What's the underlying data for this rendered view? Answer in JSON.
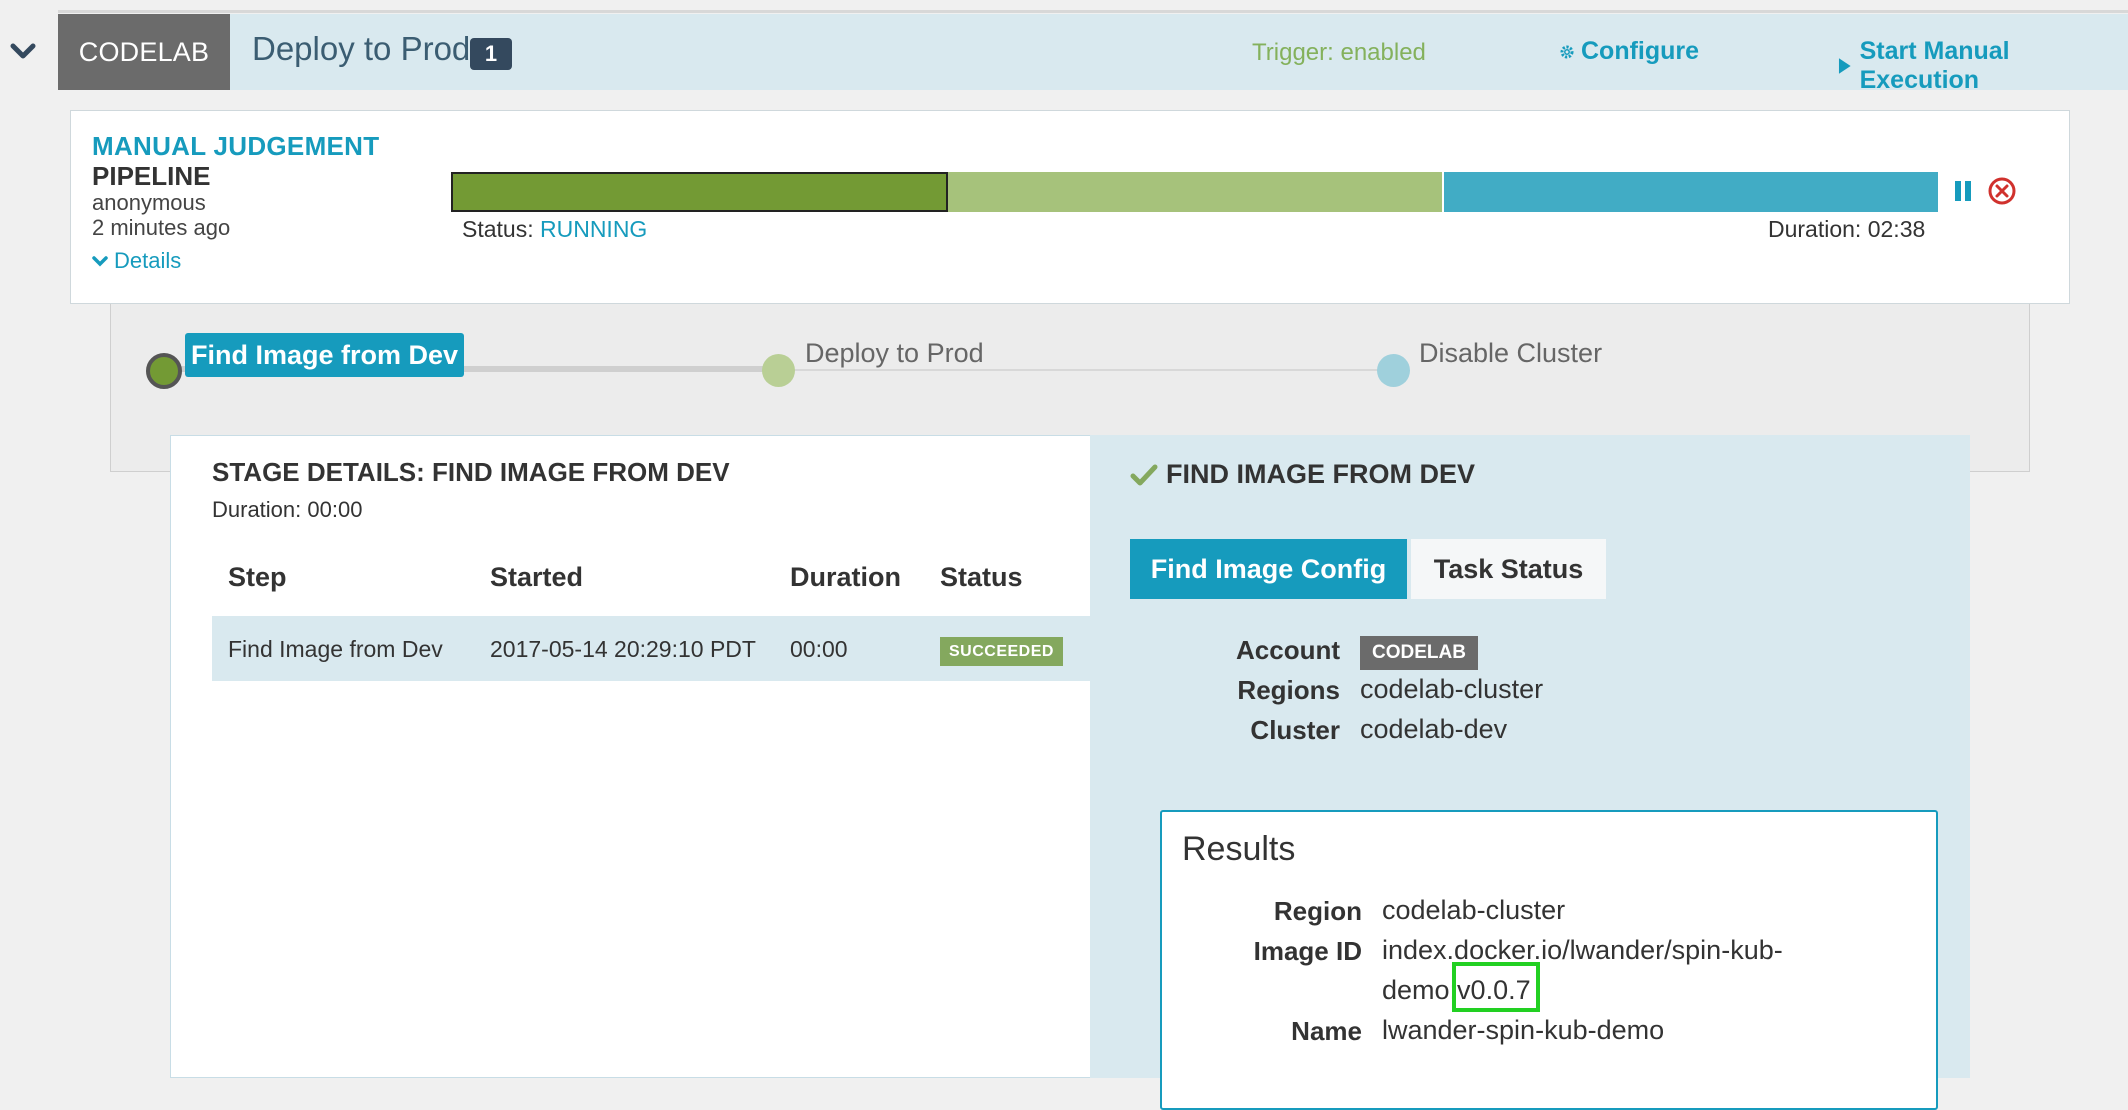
{
  "header": {
    "application": "CODELAB",
    "pipeline_name": "Deploy to Prod",
    "running_count": "1",
    "trigger_status": "Trigger: enabled",
    "configure_label": "Configure",
    "start_manual_label": "Start Manual Execution"
  },
  "execution": {
    "type": "MANUAL JUDGEMENT",
    "subtype": "PIPELINE",
    "user": "anonymous",
    "time_ago": "2 minutes ago",
    "details_label": "Details",
    "status_label": "Status: ",
    "status_value": "RUNNING",
    "duration": "Duration: 02:38"
  },
  "stages": [
    {
      "label": "Find Image from Dev",
      "state": "succeeded"
    },
    {
      "label": "Deploy to Prod",
      "state": "running"
    },
    {
      "label": "Disable Cluster",
      "state": "not-started"
    }
  ],
  "stage_details": {
    "title": "STAGE DETAILS: FIND IMAGE FROM DEV",
    "duration": "Duration: 00:00",
    "columns": [
      "Step",
      "Started",
      "Duration",
      "Status"
    ],
    "rows": [
      {
        "step": "Find Image from Dev",
        "started": "2017-05-14 20:29:10 PDT",
        "duration": "00:00",
        "status": "SUCCEEDED"
      }
    ]
  },
  "task_panel": {
    "title": "FIND IMAGE FROM DEV",
    "tabs": [
      "Find Image Config",
      "Task Status"
    ],
    "config": {
      "account_label": "Account",
      "account_value": "CODELAB",
      "regions_label": "Regions",
      "regions_value": "codelab-cluster",
      "cluster_label": "Cluster",
      "cluster_value": "codelab-dev"
    },
    "results": {
      "title": "Results",
      "region_label": "Region",
      "region_value": "codelab-cluster",
      "image_id_label": "Image ID",
      "image_id_line1": "index.docker.io/lwander/spin-kub-",
      "image_id_line2_prefix": "demo:",
      "image_id_tag": "v0.0.7",
      "name_label": "Name",
      "name_value": "lwander-spin-kub-demo"
    }
  },
  "colors": {
    "accent": "#169bbd",
    "succeeded": "#739a34",
    "running": "#a6c27b",
    "not_started": "#41acc5",
    "header_bg": "#d9e9ef",
    "highlight": "#22d022"
  }
}
